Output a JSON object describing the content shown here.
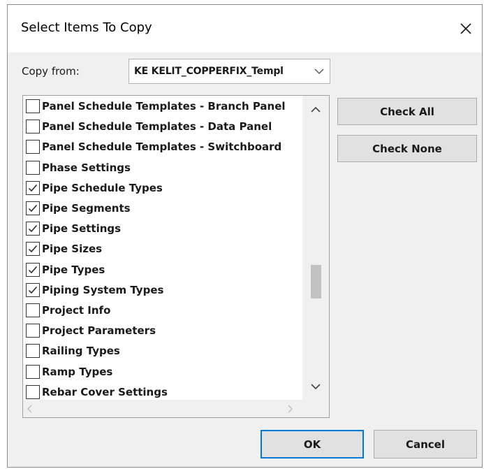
{
  "dialog": {
    "title": "Select Items To Copy",
    "close_icon": "close-icon"
  },
  "copy_from": {
    "label": "Copy from:",
    "selected": "KE KELIT_COPPERFIX_Templ"
  },
  "list": {
    "items": [
      {
        "label": "Panel Schedule Templates - Branch Panel",
        "checked": false
      },
      {
        "label": "Panel Schedule Templates - Data Panel",
        "checked": false
      },
      {
        "label": "Panel Schedule Templates - Switchboard",
        "checked": false
      },
      {
        "label": "Phase Settings",
        "checked": false
      },
      {
        "label": "Pipe Schedule Types",
        "checked": true
      },
      {
        "label": "Pipe Segments",
        "checked": true
      },
      {
        "label": "Pipe Settings",
        "checked": true
      },
      {
        "label": "Pipe Sizes",
        "checked": true
      },
      {
        "label": "Pipe Types",
        "checked": true
      },
      {
        "label": "Piping System Types",
        "checked": true
      },
      {
        "label": "Project Info",
        "checked": false
      },
      {
        "label": "Project Parameters",
        "checked": false
      },
      {
        "label": "Railing Types",
        "checked": false
      },
      {
        "label": "Ramp Types",
        "checked": false
      },
      {
        "label": "Rebar Cover Settings",
        "checked": false
      }
    ]
  },
  "buttons": {
    "check_all": "Check All",
    "check_none": "Check None",
    "ok": "OK",
    "cancel": "Cancel"
  }
}
